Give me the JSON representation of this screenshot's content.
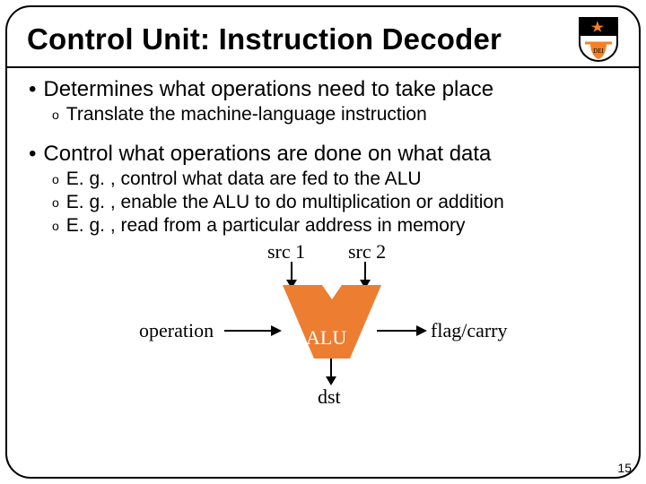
{
  "title": "Control Unit: Instruction Decoder",
  "bullets": {
    "p1": "Determines what operations need to take place",
    "p1s1": "Translate the machine-language instruction",
    "p2": "Control what operations are done on what data",
    "p2s1": "E. g. , control what data are fed to the ALU",
    "p2s2": "E. g. , enable the ALU to do multiplication or addition",
    "p2s3": "E. g. , read from a particular address in memory"
  },
  "diagram": {
    "src1": "src 1",
    "src2": "src 2",
    "operation": "operation",
    "alu": "ALU",
    "flagcarry": "flag/carry",
    "dst": "dst"
  },
  "slide_number": "15",
  "glyph": {
    "bullet1": "•",
    "bullet2": "o"
  },
  "colors": {
    "alu_fill": "#ED7D31"
  }
}
